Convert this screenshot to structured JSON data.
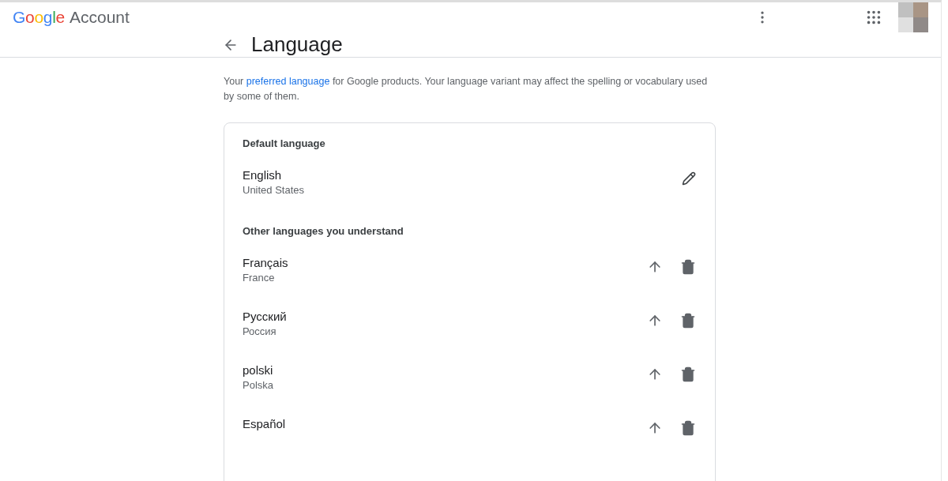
{
  "header": {
    "logo": "Google",
    "product": "Account"
  },
  "page": {
    "title": "Language",
    "intro": {
      "before": "Your",
      "link": "preferred language",
      "after": "for Google products. Your language variant may affect the spelling or vocabulary used by some of them."
    }
  },
  "default_section": {
    "heading": "Default language",
    "language": {
      "name": "English",
      "region": "United States"
    }
  },
  "other_section": {
    "heading": "Other languages you understand",
    "languages": [
      {
        "name": "Français",
        "region": "France"
      },
      {
        "name": "Русский",
        "region": "Россия"
      },
      {
        "name": "polski",
        "region": "Polska"
      },
      {
        "name": "Español"
      }
    ]
  }
}
